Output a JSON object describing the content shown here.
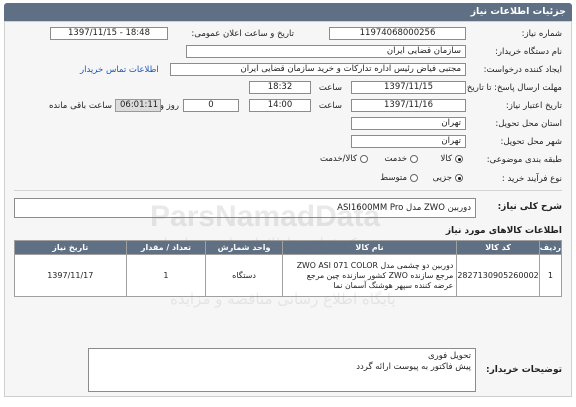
{
  "header": {
    "title": "جزئیات اطلاعات نیاز"
  },
  "form": {
    "need_number_label": "شماره نیاز:",
    "need_number": "1197406800025​6",
    "announce_label": "تاریخ و ساعت اعلان عمومی:",
    "announce_value": "1397/11/15 - 18:48",
    "buyer_label": "نام دستگاه خریدار:",
    "buyer_value": "سازمان قضایی ایران",
    "requester_label": "ایجاد کننده درخواست:",
    "requester_value": "مجتبی  فیاض رئیس اداره تدارکات و خرید سازمان قضایی ایران",
    "contact_link": "اطلاعات تماس خریدار",
    "send_deadline_label": "مهلت ارسال پاسخ: تا تاریخ:",
    "send_date": "1397/11/15",
    "time_label": "ساعت",
    "send_time": "18:32",
    "validity_label": "تاریخ اعتبار نیاز:",
    "validity_date": "1397/11/16",
    "validity_time": "14:00",
    "days_value": "0",
    "days_label": "روز و",
    "remaining_value": "06:01:11",
    "remaining_label": "ساعت باقی مانده",
    "province_label": "استان محل تحویل:",
    "province_value": "تهران",
    "city_label": "شهر محل تحویل:",
    "city_value": "تهران",
    "category_label": "طبقه بندی موضوعی:",
    "category_options": [
      "کالا",
      "خدمت",
      "کالا/خدمت"
    ],
    "category_selected": 0,
    "process_label": "نوع فرآیند خرید :",
    "process_options": [
      "جزیی",
      "متوسط"
    ],
    "process_selected": 0
  },
  "summary": {
    "label": "شرح کلی نیاز:",
    "value": "دوربین  ZWO  مدل  ASI1600MM Pro"
  },
  "goods": {
    "title": "اطلاعات کالاهای مورد نیاز",
    "headers": [
      "ردیف",
      "کد کالا",
      "نام کالا",
      "واحد شمارش",
      "تعداد / مقدار",
      "تاریخ نیاز"
    ],
    "rows": [
      {
        "row": "1",
        "code": "2827130905260002",
        "name": "دوربین دو چشمی مدل ZWO ASI 071 COLOR مرجع سازنده ZWO کشور سازنده چین مرجع عرضه کننده سپهر هوشنگ آسمان نما",
        "unit": "دستگاه",
        "qty": "1",
        "date": "1397/11/17"
      }
    ]
  },
  "buyer_notes": {
    "label": "توضیحات خریدار:",
    "lines": [
      "تحویل فوری",
      "پیش فاکتور به پیوست ارائه گردد"
    ]
  },
  "watermark": {
    "line1": "ParsNamadData",
    "line2": "مرکز فراوری اطلاعات پارس نماد داده",
    "line3": "پایگاه اطلاع رسانی مناقصه و مزایده"
  },
  "colors": {
    "header_bg": "#5f6f84",
    "link": "#1a56b8",
    "panel_bg": "#f6f6f6"
  }
}
